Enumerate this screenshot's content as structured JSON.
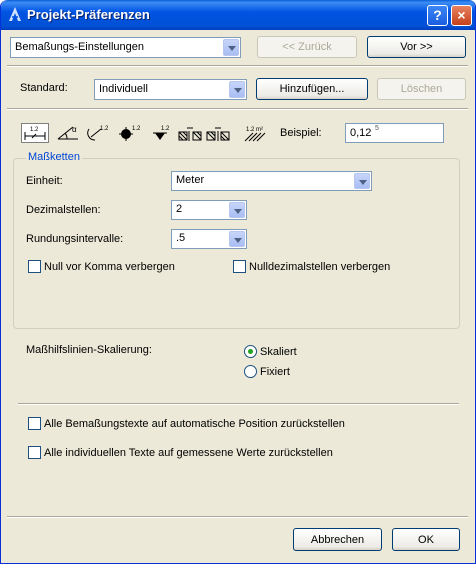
{
  "window": {
    "title": "Projekt-Präferenzen",
    "help_label": "?",
    "close_label": "×"
  },
  "nav": {
    "page_select": "Bemaßungs-Einstellungen",
    "back_label": "<< Zurück",
    "next_label": "Vor >>"
  },
  "standard": {
    "label": "Standard:",
    "value": "Individuell",
    "add_label": "Hinzufügen...",
    "delete_label": "Löschen"
  },
  "tools": {
    "icons": [
      "linear-dimension-icon",
      "angle-dimension-icon",
      "radial-dimension-icon",
      "level-dimension-icon",
      "elevation-marker-icon",
      "door-window-dimension-icon",
      "area-dimension-icon"
    ],
    "icon_texts": {
      "linear": "1.2",
      "radial": "1.2",
      "level": "1.2",
      "elevation": "1.2",
      "area": "1.2 m²"
    },
    "example_label": "Beispiel:",
    "example_value": "0,12",
    "example_superscript": "5"
  },
  "masskette": {
    "title": "Maßketten",
    "unit_label": "Einheit:",
    "unit_value": "Meter",
    "decimals_label": "Dezimalstellen:",
    "decimals_value": "2",
    "rounding_label": "Rundungsintervalle:",
    "rounding_value": ".5",
    "hide_zero_label": "Null vor Komma verbergen",
    "hide_zero_decimals_label": "Nulldezimalstellen verbergen"
  },
  "scaling": {
    "label": "Maßhilfslinien-Skalierung:",
    "option_scaled": "Skaliert",
    "option_fixed": "Fixiert",
    "selected": "Skaliert"
  },
  "resets": {
    "reset_positions_label": "Alle Bemaßungstexte auf automatische Position zurückstellen",
    "reset_texts_label": "Alle individuellen Texte auf gemessene Werte zurückstellen"
  },
  "footer": {
    "cancel_label": "Abbrechen",
    "ok_label": "OK"
  },
  "colors": {
    "titlebar": "#0054e3",
    "dialog_bg": "#ece9d8",
    "group_title": "#0046d5",
    "radio_dot": "#21a121"
  }
}
